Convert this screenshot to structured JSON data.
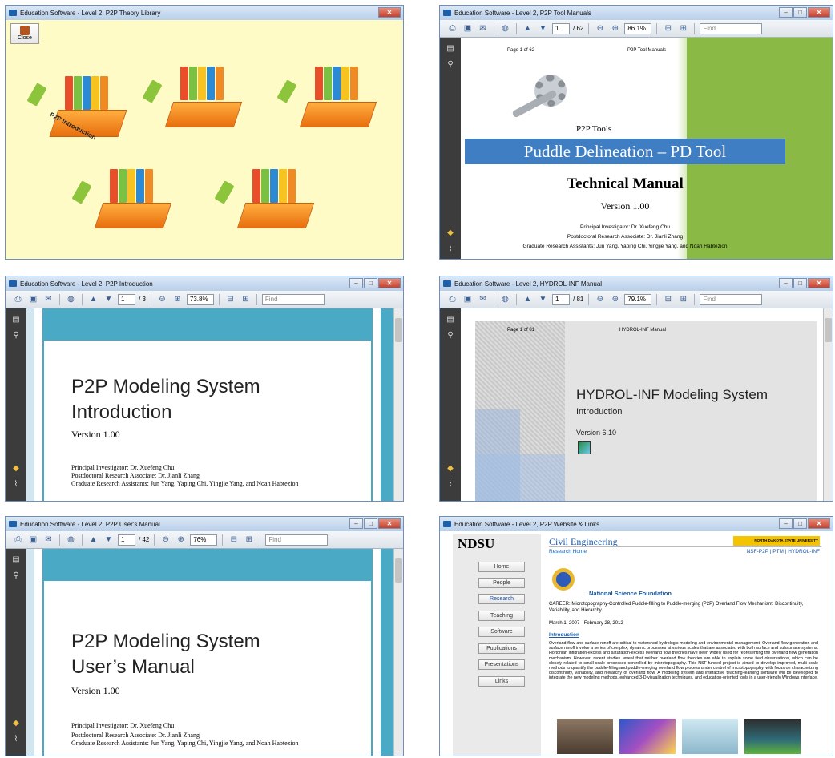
{
  "windows": {
    "library": {
      "title": "Education Software - Level 2, P2P Theory Library",
      "close_label": "Close",
      "intro_label": "P2P Introduction"
    },
    "tool_manual": {
      "title": "Education Software - Level 2, P2P Tool Manuals",
      "page_current": "1",
      "page_total": "/ 62",
      "zoom": "86.1%",
      "find_placeholder": "Find",
      "header_left": "Page 1 of 62",
      "header_right": "P2P Tool Manuals",
      "subtitle": "P2P Tools",
      "banner": "Puddle Delineation – PD Tool",
      "heading": "Technical Manual",
      "version": "Version 1.00",
      "pi": "Principal Investigator: Dr. Xuefeng Chu",
      "postdoc": "Postdoctoral Research Associate: Dr. Jianli Zhang",
      "grads": "Graduate Research Assistants: Jun Yang, Yaping Chi, Yingjie Yang, and Noah Habtezion"
    },
    "introduction": {
      "title": "Education Software - Level 2, P2P Introduction",
      "page_current": "1",
      "page_total": "/ 3",
      "zoom": "73.8%",
      "find_placeholder": "Find",
      "heading_line1": "P2P Modeling System",
      "heading_line2": "Introduction",
      "version": "Version 1.00",
      "pi": "Principal Investigator: Dr. Xuefeng Chu",
      "postdoc": "Postdoctoral Research Associate: Dr. Jianli Zhang",
      "grads": "Graduate Research Assistants: Jun Yang, Yaping Chi, Yingjie Yang, and Noah Habtezion"
    },
    "hydrol": {
      "title": "Education Software - Level 2, HYDROL-INF Manual",
      "page_current": "1",
      "page_total": "/ 81",
      "zoom": "79.1%",
      "find_placeholder": "Find",
      "header_left": "Page 1 of 81",
      "header_right": "HYDROL-INF Manual",
      "heading": "HYDROL-INF Modeling System",
      "subheading": "Introduction",
      "version": "Version 6.10"
    },
    "users_manual": {
      "title": "Education Software - Level 2, P2P User's Manual",
      "page_current": "1",
      "page_total": "/ 42",
      "zoom": "76%",
      "find_placeholder": "Find",
      "heading_line1": "P2P Modeling System",
      "heading_line2": "User’s Manual",
      "version": "Version 1.00",
      "pi": "Principal Investigator: Dr. Xuefeng Chu",
      "postdoc": "Postdoctoral Research Associate: Dr. Jianli Zhang",
      "grads": "Graduate Research Assistants: Jun Yang, Yaping Chi, Yingjie Yang, and Noah Habtezion"
    },
    "website": {
      "title": "Education Software - Level 2, P2P Website & Links",
      "logo": "NDSU",
      "dept": "Civil Engineering",
      "ndsu_badge": "NORTH DAKOTA STATE UNIVERSITY",
      "research_home": "Research Home",
      "top_links": "NSF-P2P | PTM | HYDROL-INF",
      "nav": [
        "Home",
        "People",
        "Research",
        "Teaching",
        "Software",
        "Publications",
        "Presentations",
        "Links"
      ],
      "nsf": "National Science Foundation",
      "career": "CAREER: Microtopography-Controlled Puddle-filling to Puddle-merging (P2P) Overland Flow Mechanism: Discontinuity, Variability, and Hierarchy",
      "dates": "March 1, 2007 - February 28, 2012",
      "intro_heading": "Introduction",
      "body": "Overland flow and surface runoff are critical to watershed hydrologic modeling and environmental management. Overland flow generation and surface runoff involve a series of complex, dynamic processes at various scales that are associated with both surface and subsurface systems. Hortonian infiltration-excess and saturation-excess overland flow theories have been widely used for representing the overland flow generation mechanism. However, recent studies reveal that neither overland flow theories are able to explain some field observations, which can be closely related to small-scale processes controlled by microtopography. This NSF-funded project is aimed to develop improved, multi-scale methods to quantify the puddle-filling and puddle-merging overland flow process under control of microtopography, with focus on characterizing discontinuity, variability, and hierarchy of overland flow. A modeling system and interactive teaching-learning software will be developed to integrate the new modeling methods, enhanced 3-D visualization techniques, and education-oriented tools in a user-friendly Windows interface."
    }
  }
}
